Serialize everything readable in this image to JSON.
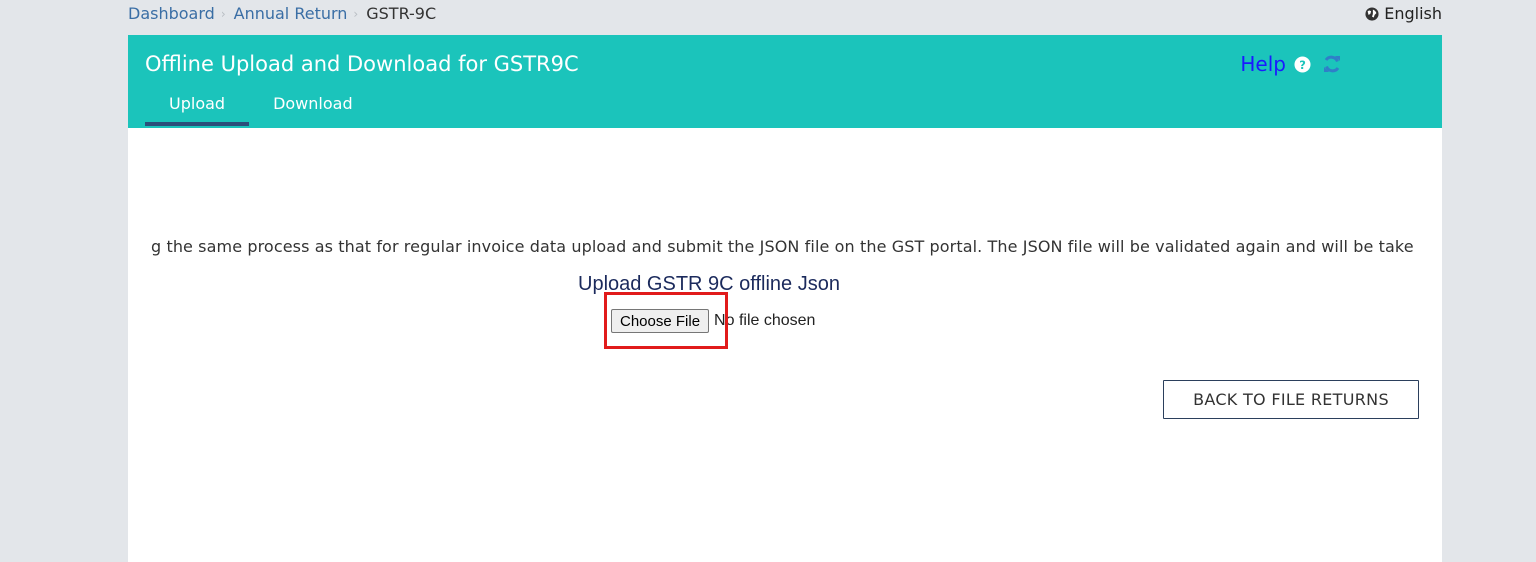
{
  "breadcrumb": {
    "items": [
      "Dashboard",
      "Annual Return"
    ],
    "current": "GSTR-9C"
  },
  "language": {
    "label": "English",
    "icon": "globe-icon"
  },
  "panel": {
    "title": "Offline Upload and Download for GSTR9C",
    "tabs": [
      {
        "label": "Upload",
        "active": true
      },
      {
        "label": "Download",
        "active": false
      }
    ],
    "help_label": "Help",
    "help_icon": "question-circle-icon",
    "refresh_icon": "refresh-icon"
  },
  "upload": {
    "instruction": "g the same process as that for regular invoice data upload and submit the JSON file on the GST portal. The JSON file will be validated again and will be take",
    "title": "Upload GSTR 9C offline Json",
    "choose_file_label": "Choose File",
    "file_status": "No file chosen"
  },
  "actions": {
    "back_label": "BACK TO FILE RETURNS"
  },
  "colors": {
    "header": "#1bc4bb",
    "tab_underline": "#2b4f7a",
    "highlight": "#e11b1b",
    "link": "#3a6ea5"
  }
}
